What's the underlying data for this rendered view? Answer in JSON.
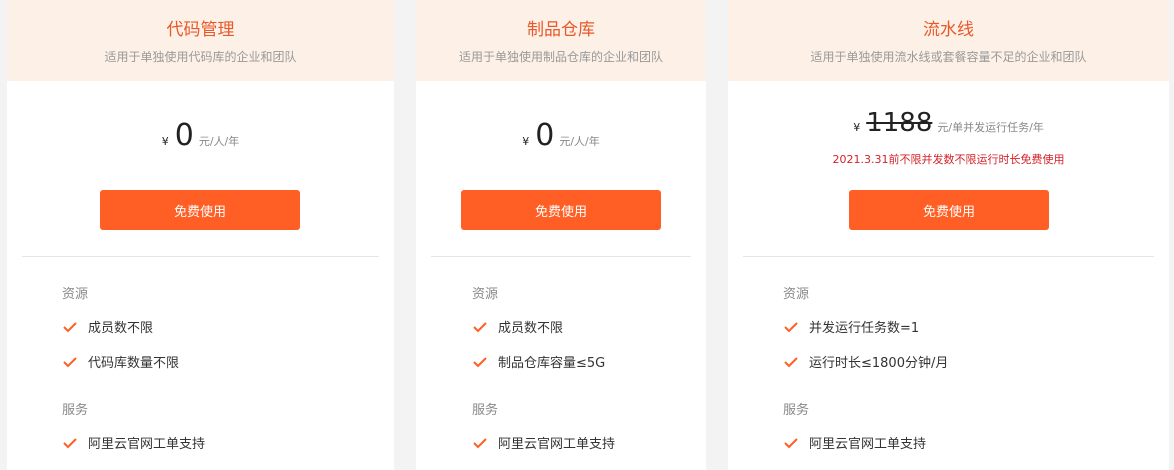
{
  "colors": {
    "accent": "#ff5f24",
    "title": "#e8582a",
    "header_bg": "#fdf0e7",
    "promo": "#d4222a",
    "check": "#ff5f24"
  },
  "plans": [
    {
      "title": "代码管理",
      "description": "适用于单独使用代码库的企业和团队",
      "currency": "¥",
      "price": "0",
      "unit": "元/人/年",
      "cta": "免费使用",
      "resources_label": "资源",
      "resources": [
        "成员数不限",
        "代码库数量不限"
      ],
      "services_label": "服务",
      "services": [
        "阿里云官网工单支持"
      ]
    },
    {
      "title": "制品仓库",
      "description": "适用于单独使用制品仓库的企业和团队",
      "currency": "¥",
      "price": "0",
      "unit": "元/人/年",
      "cta": "免费使用",
      "resources_label": "资源",
      "resources": [
        "成员数不限",
        "制品仓库容量≤5G"
      ],
      "services_label": "服务",
      "services": [
        "阿里云官网工单支持"
      ]
    },
    {
      "title": "流水线",
      "description": "适用于单独使用流水线或套餐容量不足的企业和团队",
      "currency": "¥",
      "price": "1188",
      "price_struck": true,
      "unit": "元/单并发运行任务/年",
      "promo": "2021.3.31前不限并发数不限运行时长免费使用",
      "cta": "免费使用",
      "resources_label": "资源",
      "resources": [
        "并发运行任务数=1",
        "运行时长≤1800分钟/月"
      ],
      "services_label": "服务",
      "services": [
        "阿里云官网工单支持"
      ]
    }
  ]
}
